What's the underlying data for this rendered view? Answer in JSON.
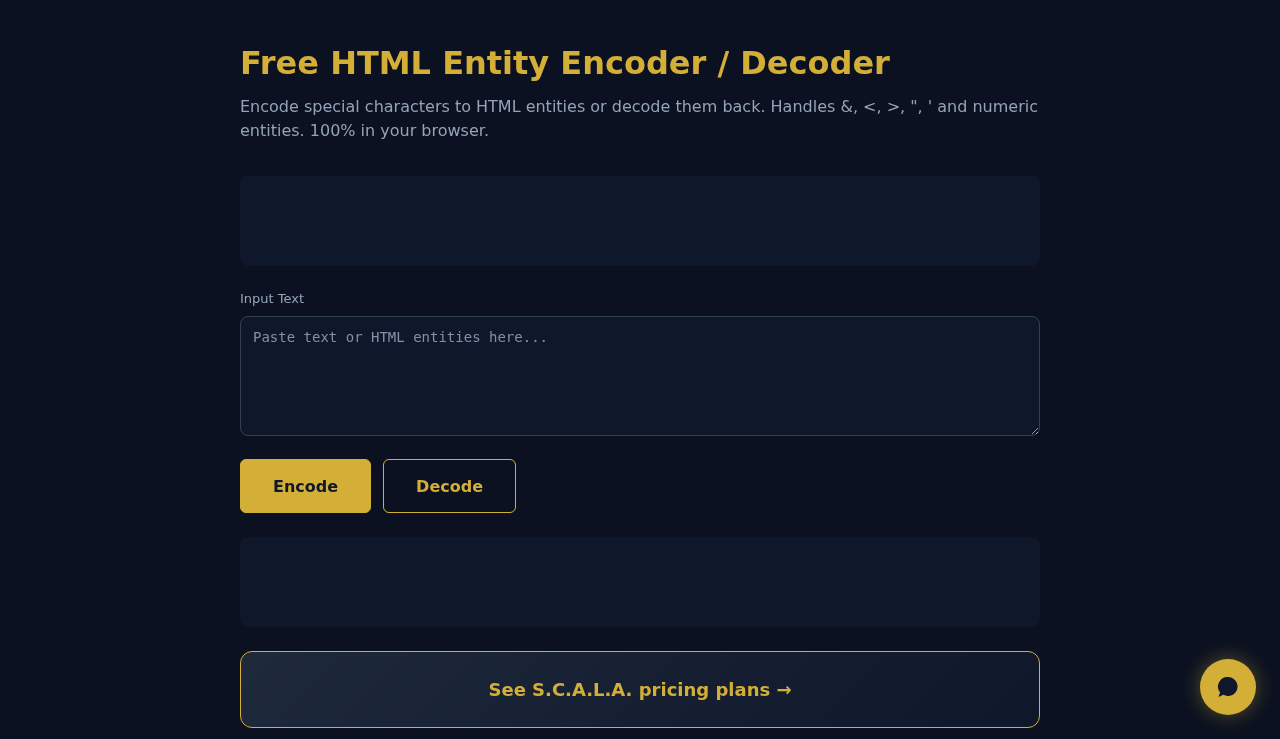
{
  "header": {
    "title": "Free HTML Entity Encoder / Decoder",
    "subtitle": "Encode special characters to HTML entities or decode them back. Handles &, <, >, \", ' and numeric entities. 100% in your browser."
  },
  "input": {
    "label": "Input Text",
    "placeholder": "Paste text or HTML entities here..."
  },
  "actions": [
    {
      "label": "Encode",
      "kind": "primary"
    },
    {
      "label": "Decode",
      "kind": "secondary"
    }
  ],
  "cta": {
    "label": "See S.C.A.L.A. pricing plans →"
  }
}
